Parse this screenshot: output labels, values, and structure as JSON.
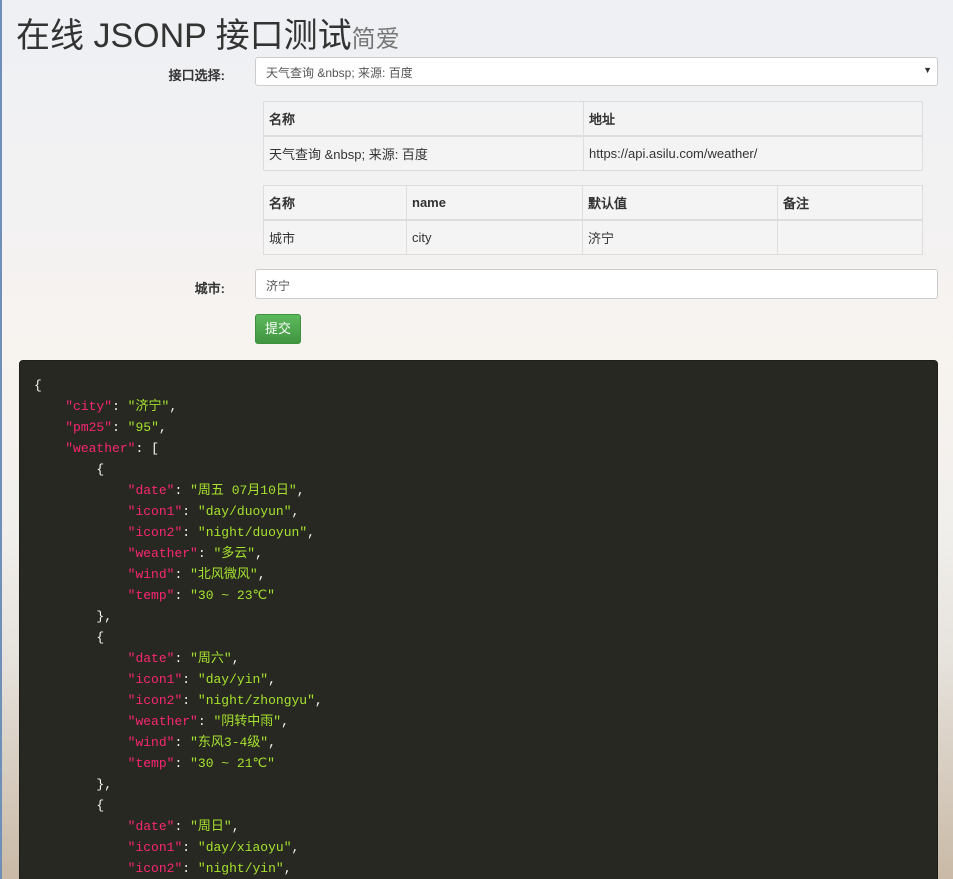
{
  "header": {
    "title": "在线 JSONP 接口测试",
    "subtitle": "简爱"
  },
  "form": {
    "api_label": "接口选择:",
    "api_selected": "天气查询 &nbsp; 来源: 百度",
    "city_label": "城市:",
    "city_value": "济宁",
    "submit": "提交"
  },
  "api_table": {
    "headers": [
      "名称",
      "地址"
    ],
    "row": [
      "天气查询 &nbsp; 来源: 百度",
      "https://api.asilu.com/weather/"
    ]
  },
  "param_table": {
    "headers": [
      "名称",
      "name",
      "默认值",
      "备注"
    ],
    "row": [
      "城市",
      "city",
      "济宁",
      ""
    ]
  },
  "result_lines": [
    {
      "i": 0,
      "t": "{"
    },
    {
      "i": 1,
      "k": "city",
      "v": "济宁",
      "p": ","
    },
    {
      "i": 1,
      "k": "pm25",
      "v": "95",
      "p": ","
    },
    {
      "i": 1,
      "k": "weather",
      "t": "["
    },
    {
      "i": 2,
      "t": "{"
    },
    {
      "i": 3,
      "k": "date",
      "v": "周五 07月10日",
      "p": ","
    },
    {
      "i": 3,
      "k": "icon1",
      "v": "day/duoyun",
      "p": ","
    },
    {
      "i": 3,
      "k": "icon2",
      "v": "night/duoyun",
      "p": ","
    },
    {
      "i": 3,
      "k": "weather",
      "v": "多云",
      "p": ","
    },
    {
      "i": 3,
      "k": "wind",
      "v": "北风微风",
      "p": ","
    },
    {
      "i": 3,
      "k": "temp",
      "v": "30 ~ 23℃",
      "p": ""
    },
    {
      "i": 2,
      "t": "},"
    },
    {
      "i": 2,
      "t": "{"
    },
    {
      "i": 3,
      "k": "date",
      "v": "周六",
      "p": ","
    },
    {
      "i": 3,
      "k": "icon1",
      "v": "day/yin",
      "p": ","
    },
    {
      "i": 3,
      "k": "icon2",
      "v": "night/zhongyu",
      "p": ","
    },
    {
      "i": 3,
      "k": "weather",
      "v": "阴转中雨",
      "p": ","
    },
    {
      "i": 3,
      "k": "wind",
      "v": "东风3-4级",
      "p": ","
    },
    {
      "i": 3,
      "k": "temp",
      "v": "30 ~ 21℃",
      "p": ""
    },
    {
      "i": 2,
      "t": "},"
    },
    {
      "i": 2,
      "t": "{"
    },
    {
      "i": 3,
      "k": "date",
      "v": "周日",
      "p": ","
    },
    {
      "i": 3,
      "k": "icon1",
      "v": "day/xiaoyu",
      "p": ","
    },
    {
      "i": 3,
      "k": "icon2",
      "v": "night/yin",
      "p": ","
    }
  ]
}
